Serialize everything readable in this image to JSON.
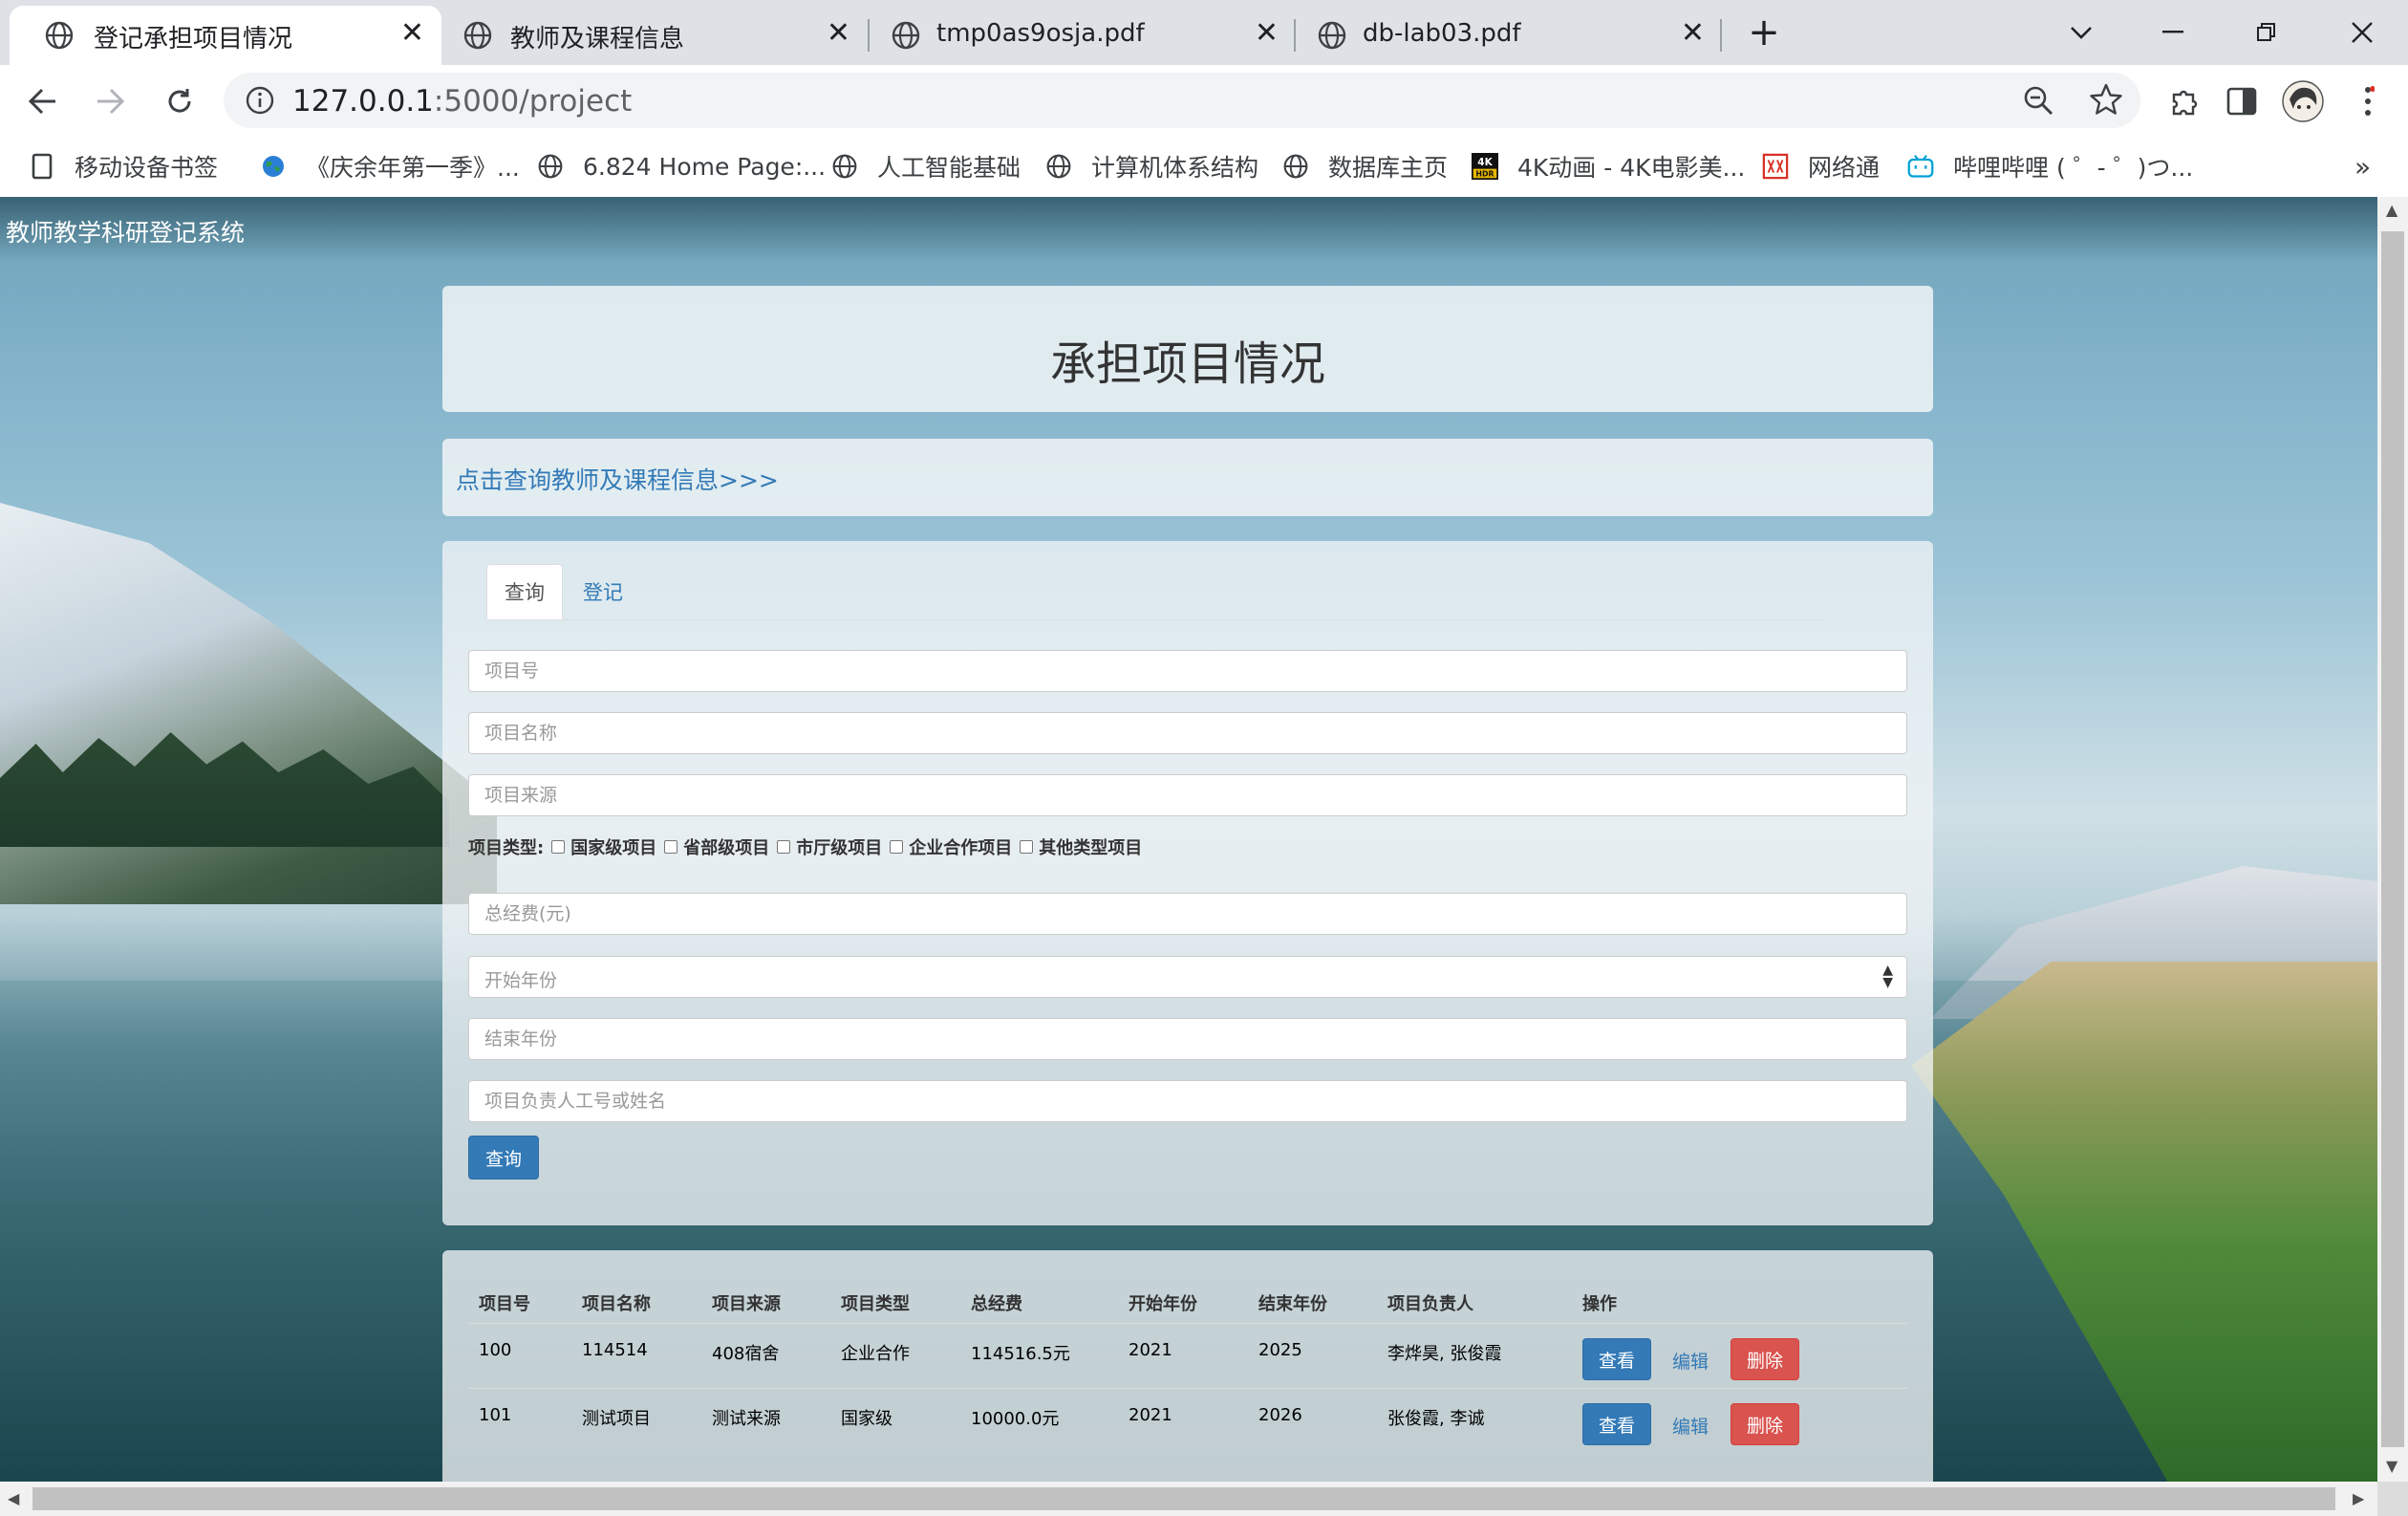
{
  "browser": {
    "tabs": [
      {
        "title": "登记承担项目情况",
        "active": true
      },
      {
        "title": "教师及课程信息",
        "active": false
      },
      {
        "title": "tmp0as9osja.pdf",
        "active": false
      },
      {
        "title": "db-lab03.pdf",
        "active": false
      }
    ],
    "new_tab": "+",
    "url_host": "127.0.0.1",
    "url_path": ":5000/project",
    "bookmarks": [
      {
        "label": "移动设备书签",
        "icon": "bookmark-folder-icon"
      },
      {
        "label": "《庆余年第一季》...",
        "icon": "earth-icon"
      },
      {
        "label": "6.824 Home Page:...",
        "icon": "globe-icon"
      },
      {
        "label": "人工智能基础",
        "icon": "globe-icon"
      },
      {
        "label": "计算机体系结构",
        "icon": "globe-icon"
      },
      {
        "label": "数据库主页",
        "icon": "globe-icon"
      },
      {
        "label": "4K动画 - 4K电影美...",
        "icon": "4k-hdr-icon"
      },
      {
        "label": "网络通",
        "icon": "network-icon"
      },
      {
        "label": "哔哩哔哩 ( ゜- ゜)つ...",
        "icon": "bilibili-icon"
      }
    ],
    "bookmarks_more": "»"
  },
  "page": {
    "site_title": "教师教学科研登记系统",
    "title": "承担项目情况",
    "teacher_link": "点击查询教师及课程信息>>>",
    "tabs": {
      "query": "查询",
      "register": "登记"
    },
    "form": {
      "project_id_placeholder": "项目号",
      "project_name_placeholder": "项目名称",
      "project_source_placeholder": "项目来源",
      "type_label": "项目类型:",
      "type_options": [
        "国家级项目",
        "省部级项目",
        "市厅级项目",
        "企业合作项目",
        "其他类型项目"
      ],
      "total_fund_placeholder": "总经费(元)",
      "start_year_placeholder": "开始年份",
      "end_year_placeholder": "结束年份",
      "leader_placeholder": "项目负责人工号或姓名",
      "submit_label": "查询"
    },
    "table": {
      "headers": [
        "项目号",
        "项目名称",
        "项目来源",
        "项目类型",
        "总经费",
        "开始年份",
        "结束年份",
        "项目负责人",
        "操作"
      ],
      "rows": [
        {
          "id": "100",
          "name": "114514",
          "source": "408宿舍",
          "type": "企业合作",
          "fund": "114516.5元",
          "start": "2021",
          "end": "2025",
          "leader": "李烨昊, 张俊霞"
        },
        {
          "id": "101",
          "name": "测试项目",
          "source": "测试来源",
          "type": "国家级",
          "fund": "10000.0元",
          "start": "2021",
          "end": "2026",
          "leader": "张俊霞, 李诚"
        }
      ],
      "actions": {
        "view": "查看",
        "edit": "编辑",
        "delete": "删除"
      }
    }
  },
  "colors": {
    "primary": "#337ab7",
    "danger": "#d9534f",
    "tab_strip": "#dee1e6"
  }
}
